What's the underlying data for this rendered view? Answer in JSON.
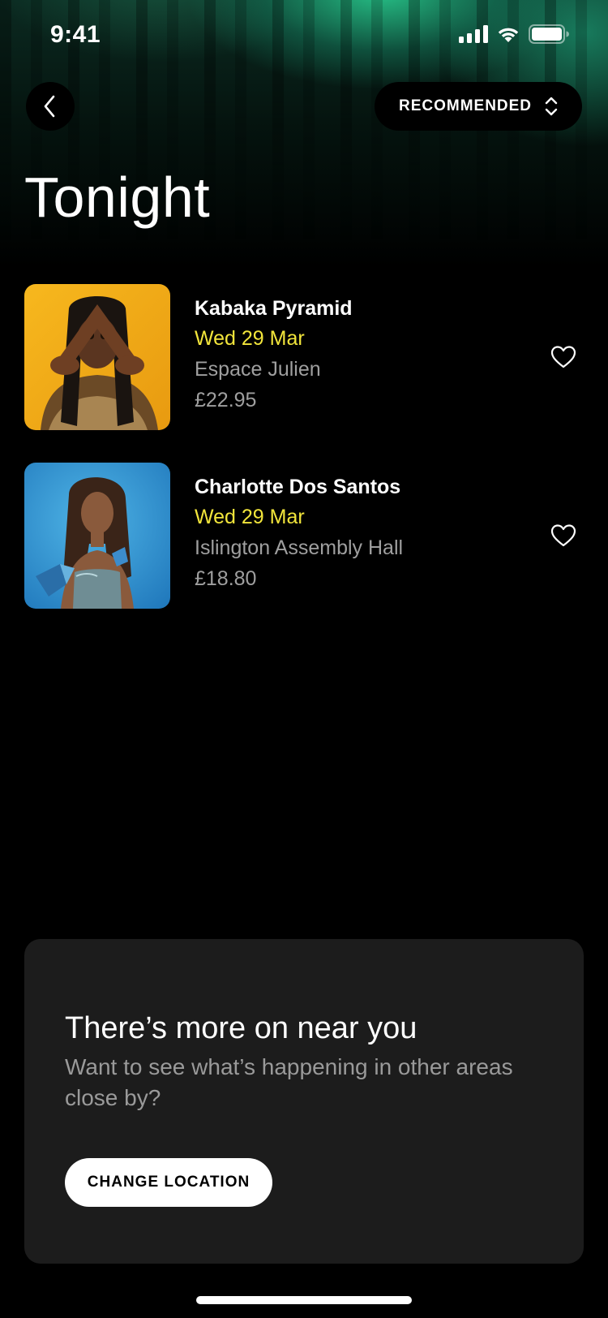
{
  "status_bar": {
    "time": "9:41"
  },
  "header": {
    "back_icon": "chevron-left-icon",
    "sort_label": "RECOMMENDED",
    "sort_icon": "chevron-up-down-icon"
  },
  "page": {
    "title": "Tonight"
  },
  "events": [
    {
      "name": "Kabaka Pyramid",
      "date": "Wed 29 Mar",
      "venue": "Espace Julien",
      "price": "£22.95"
    },
    {
      "name": "Charlotte Dos Santos",
      "date": "Wed 29 Mar",
      "venue": "Islington Assembly Hall",
      "price": "£18.80"
    }
  ],
  "promo": {
    "title": "There’s more on near you",
    "text": "Want to see what’s happening in other areas close by?",
    "button_label": "CHANGE LOCATION"
  },
  "colors": {
    "accent_date": "#f2e53b",
    "muted_text": "#9f9f9f",
    "card_bg": "#1c1c1c"
  }
}
